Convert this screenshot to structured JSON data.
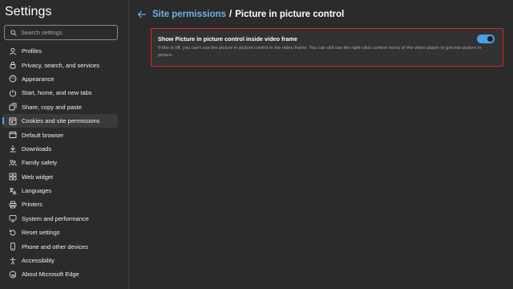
{
  "sidebar": {
    "title": "Settings",
    "search_placeholder": "Search settings",
    "items": [
      {
        "label": "Profiles",
        "icon": "profile-icon"
      },
      {
        "label": "Privacy, search, and services",
        "icon": "lock-icon"
      },
      {
        "label": "Appearance",
        "icon": "appearance-icon"
      },
      {
        "label": "Start, home, and new tabs",
        "icon": "power-icon"
      },
      {
        "label": "Share, copy and paste",
        "icon": "share-icon"
      },
      {
        "label": "Cookies and site permissions",
        "icon": "cookies-icon",
        "active": true
      },
      {
        "label": "Default browser",
        "icon": "browser-icon"
      },
      {
        "label": "Downloads",
        "icon": "download-icon"
      },
      {
        "label": "Family safety",
        "icon": "family-icon"
      },
      {
        "label": "Web widget",
        "icon": "widget-icon"
      },
      {
        "label": "Languages",
        "icon": "languages-icon"
      },
      {
        "label": "Printers",
        "icon": "printer-icon"
      },
      {
        "label": "System and performance",
        "icon": "system-icon"
      },
      {
        "label": "Reset settings",
        "icon": "reset-icon"
      },
      {
        "label": "Phone and other devices",
        "icon": "phone-icon"
      },
      {
        "label": "Accessibility",
        "icon": "accessibility-icon"
      },
      {
        "label": "About Microsoft Edge",
        "icon": "edge-icon"
      }
    ]
  },
  "header": {
    "parent_link": "Site permissions",
    "separator": "/",
    "current": "Picture in picture control"
  },
  "setting": {
    "title": "Show Picture in picture control inside video frame",
    "description": "If this is off, you can't use the picture in picture control in the video frame. You can still use the right-click context menu of the video player to get into picture in picture.",
    "enabled": true
  },
  "colors": {
    "accent": "#4a9fe6",
    "link": "#6fb0ec",
    "highlight_border": "#d9242b",
    "background": "#2b2b2b"
  }
}
